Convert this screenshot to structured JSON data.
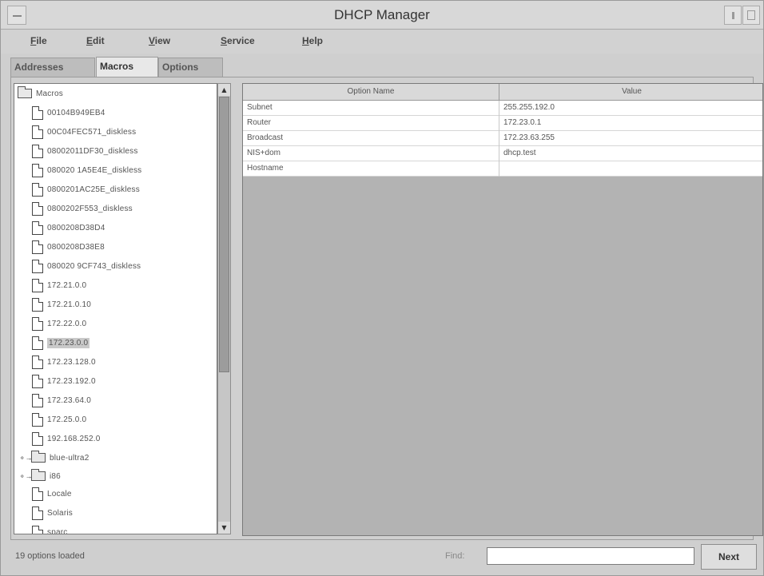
{
  "window": {
    "title": "DHCP Manager"
  },
  "menu": [
    {
      "label": "File",
      "mnemonic": "F",
      "rest": "ile"
    },
    {
      "label": "Edit",
      "mnemonic": "E",
      "rest": "dit"
    },
    {
      "label": "View",
      "mnemonic": "V",
      "rest": "iew"
    },
    {
      "label": "Service",
      "mnemonic": "S",
      "rest": "ervice"
    },
    {
      "label": "Help",
      "mnemonic": "H",
      "rest": "elp"
    }
  ],
  "tabs": [
    {
      "label": "Addresses"
    },
    {
      "label": "Macros"
    },
    {
      "label": "Options"
    }
  ],
  "tree": {
    "root_label": "Macros",
    "items": [
      "00104B949EB4",
      "00C04FEC571_diskless",
      "08002011DF30_diskless",
      "080020 1A5E4E_diskless",
      "0800201AC25E_diskless",
      "0800202F553_diskless",
      "0800208D38D4",
      "0800208D38E8",
      "080020 9CF743_diskless",
      "172.21.0.0",
      "172.21.0.10",
      "172.22.0.0",
      "172.23.0.0",
      "172.23.128.0",
      "172.23.192.0",
      "172.23.64.0",
      "172.25.0.0",
      "192.168.252.0"
    ],
    "selected": "172.23.0.0",
    "folders": [
      "blue-ultra2",
      "i86"
    ],
    "trailing_items": [
      "Locale",
      "Solaris",
      "sparc"
    ]
  },
  "table": {
    "columns": [
      "Option Name",
      "Value"
    ],
    "rows": [
      {
        "name": "Subnet",
        "value": "255.255.192.0"
      },
      {
        "name": "Router",
        "value": "172.23.0.1"
      },
      {
        "name": "Broadcast",
        "value": "172.23.63.255"
      },
      {
        "name": "NIS+dom",
        "value": "dhcp.test"
      },
      {
        "name": "Hostname",
        "value": ""
      }
    ]
  },
  "statusbar": {
    "status_text": "19 options loaded",
    "find_label": "Find:",
    "find_value": "",
    "next_label": "Next"
  }
}
